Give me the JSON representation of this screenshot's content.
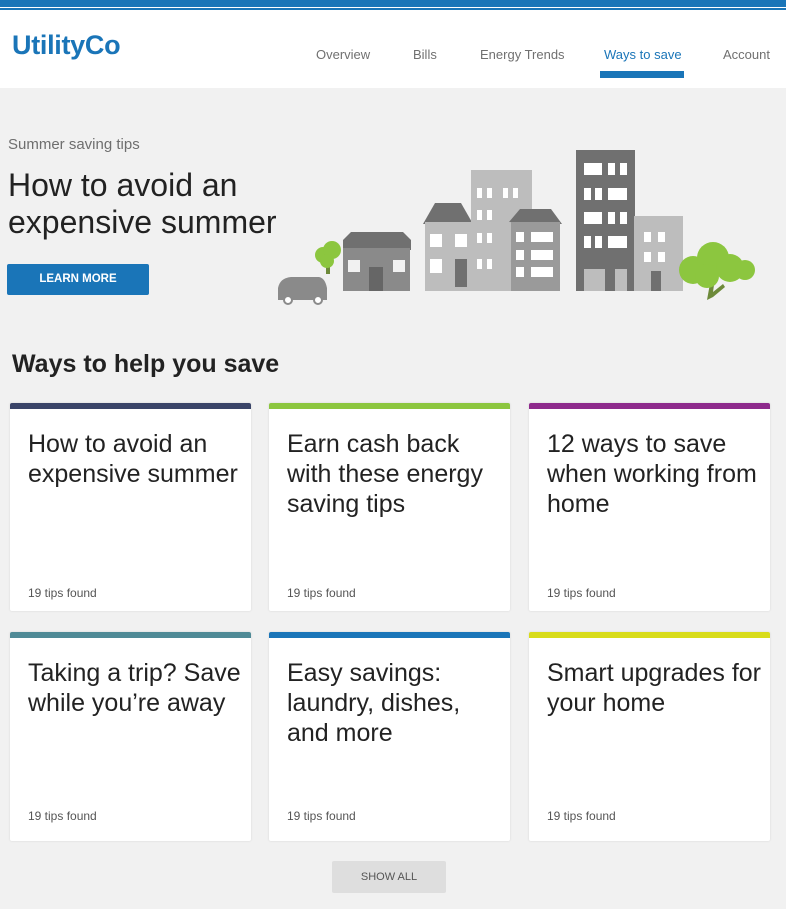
{
  "brand": {
    "logo": "UtilityCo",
    "accent": "#1a75b8"
  },
  "nav": {
    "items": [
      {
        "label": "Overview",
        "active": false
      },
      {
        "label": "Bills",
        "active": false
      },
      {
        "label": "Energy Trends",
        "active": false
      },
      {
        "label": "Ways to save",
        "active": true
      },
      {
        "label": "Account",
        "active": false
      }
    ]
  },
  "hero": {
    "kicker": "Summer saving tips",
    "title": "How to avoid an expensive summer",
    "cta": "LEARN MORE"
  },
  "section": {
    "title": "Ways to help you save"
  },
  "cards": [
    {
      "title": "How to avoid an expensive summer",
      "count": "19 tips found",
      "color": "#3a4468"
    },
    {
      "title": "Earn cash back with these energy saving tips",
      "count": "19 tips found",
      "color": "#8cc63f"
    },
    {
      "title": "12 ways to save when working from home",
      "count": "19 tips found",
      "color": "#8e2a8c"
    },
    {
      "title": "Taking a trip? Save while you’re away",
      "count": "19 tips found",
      "color": "#4f8a96"
    },
    {
      "title": "Easy savings: laundry, dishes, and more",
      "count": "19 tips found",
      "color": "#1a75b8"
    },
    {
      "title": "Smart upgrades for your home",
      "count": "19 tips found",
      "color": "#d8dc1a"
    }
  ],
  "show_all": "SHOW ALL"
}
